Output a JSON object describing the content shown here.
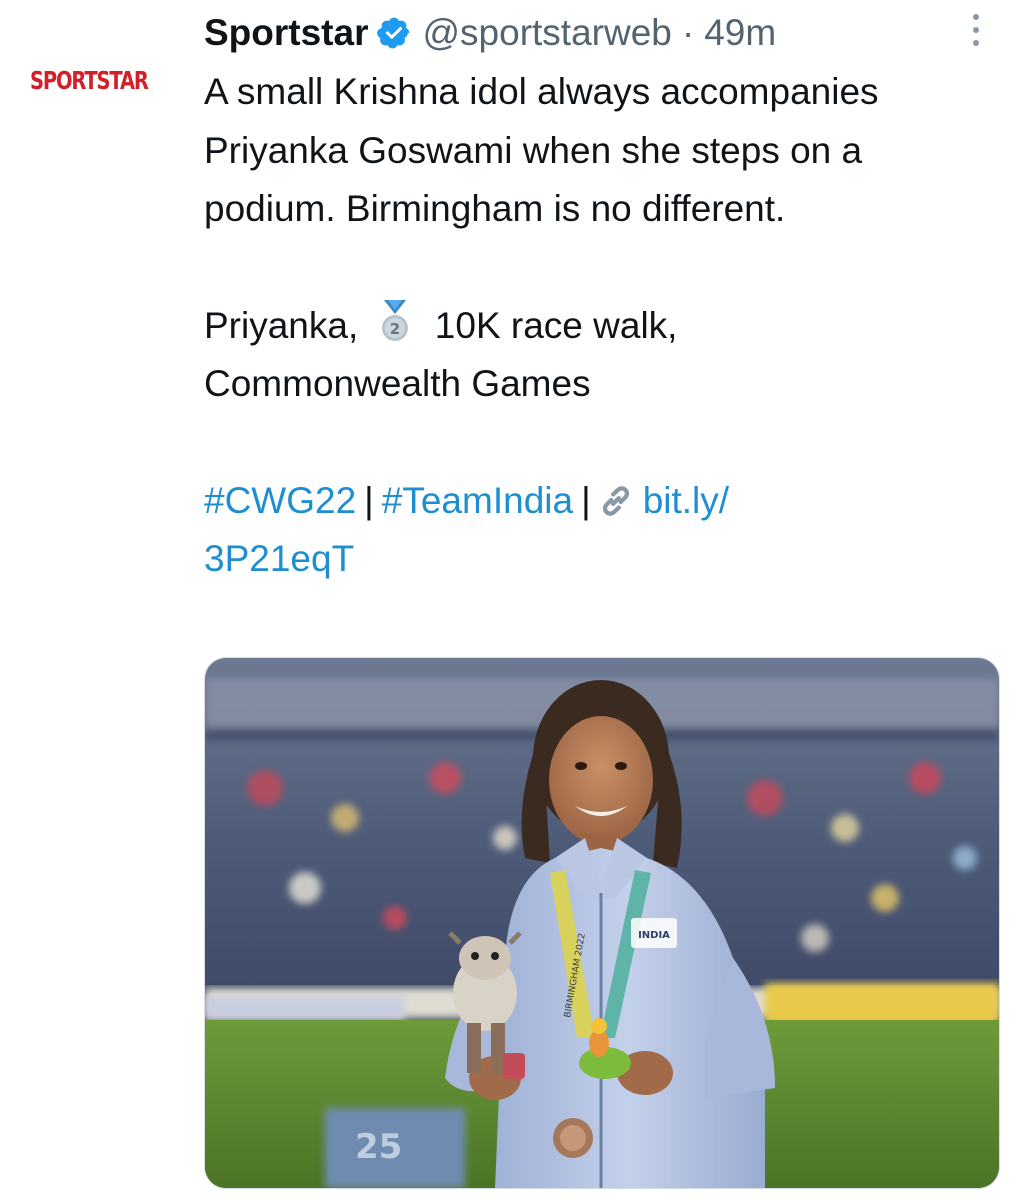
{
  "author": {
    "avatar_logo_text": "SPORTSTAR",
    "display_name": "Sportstar",
    "handle": "@sportstarweb",
    "separator": "·",
    "time_ago": "49m",
    "verified": true
  },
  "tweet": {
    "paragraph_1": "A small Krishna idol always accompanies Priyanka Goswami when she steps on a podium. Birmingham is no different.",
    "line_2a_prefix": "Priyanka,",
    "line_2a_suffix": "10K race walk,",
    "line_2b": "Commonwealth Games",
    "medal_number": "2",
    "hashtags": [
      "#CWG22",
      "#TeamIndia"
    ],
    "separator": "|",
    "link_part1": "bit.ly/",
    "link_part2": "3P21eqT"
  },
  "media": {
    "jacket_text": "INDIA",
    "lanyard_text": "BIRMINGHAM 2022",
    "board_text": "25"
  },
  "icons": {
    "verified": "verified-badge-icon",
    "more": "more-options-icon",
    "medal": "second-place-medal-icon",
    "link": "link-icon"
  },
  "colors": {
    "brand_red": "#d32028",
    "link_blue": "#1d8fd0",
    "verified_blue": "#1d9bf0",
    "muted_gray": "#536471"
  }
}
